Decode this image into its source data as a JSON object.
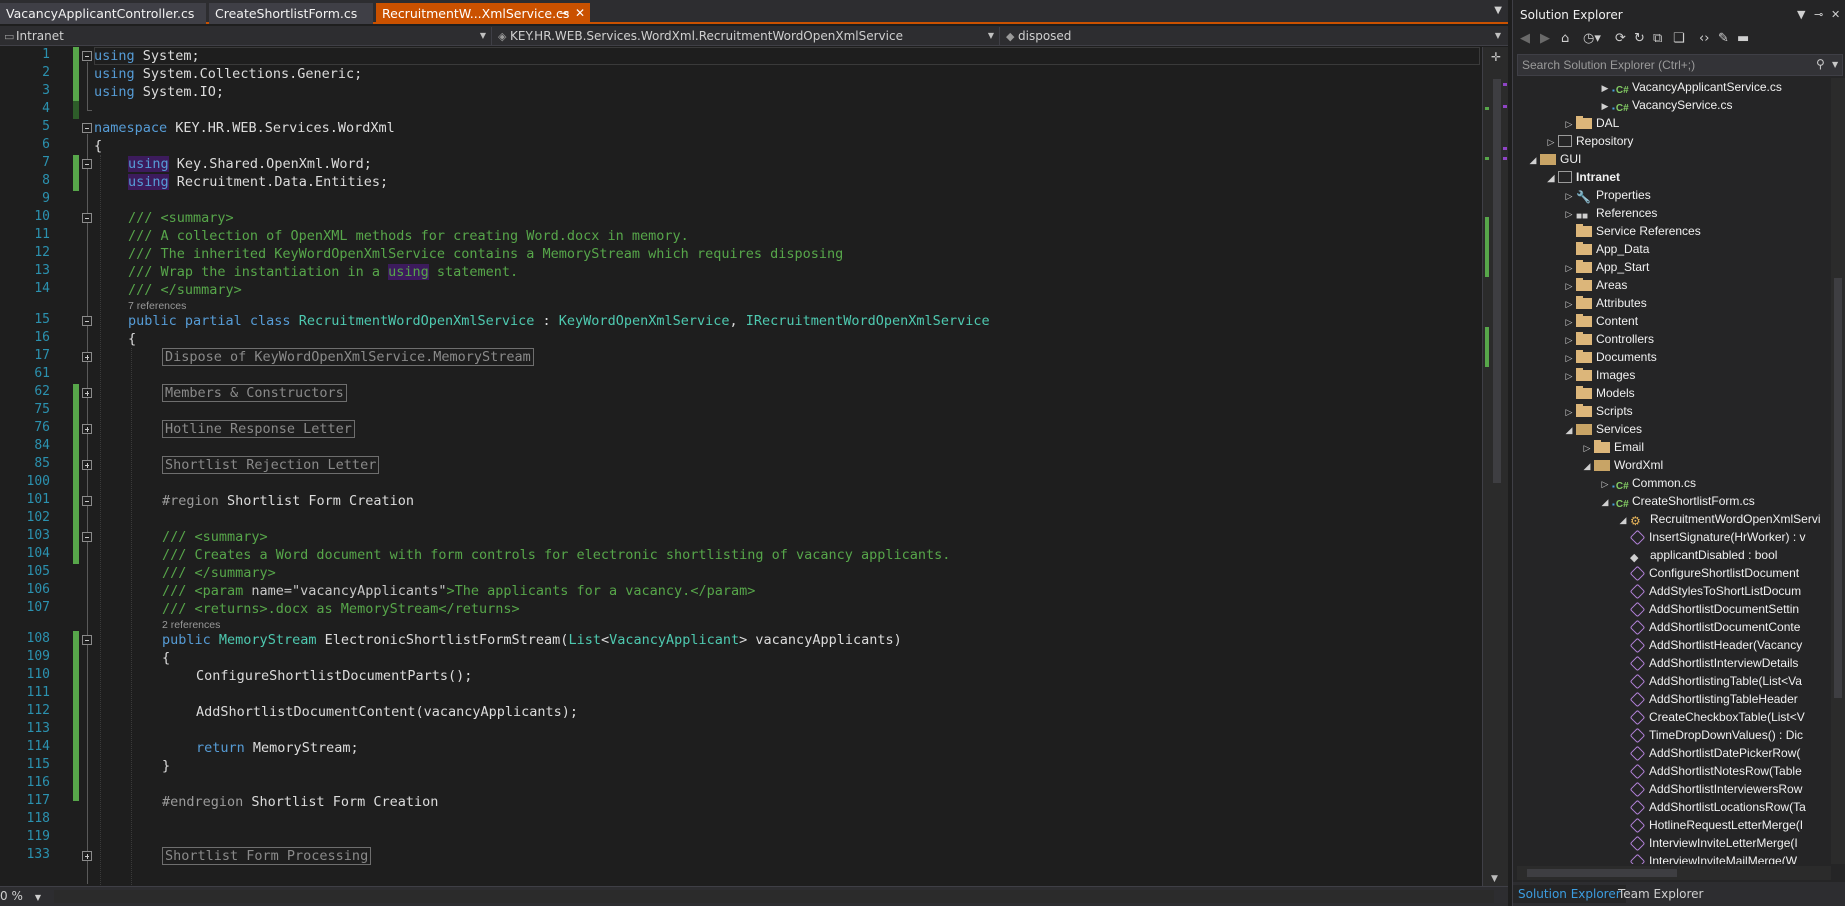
{
  "tabs": [
    {
      "label": "VacancyApplicantController.cs",
      "active": false
    },
    {
      "label": "CreateShortlistForm.cs",
      "active": false
    },
    {
      "label": "RecruitmentW...XmlService.cs",
      "active": true
    }
  ],
  "tab_pin_icon": "pin-icon",
  "tab_close_icon": "close-icon",
  "nav": {
    "project": "Intranet",
    "type": "KEY.HR.WEB.Services.WordXml.RecruitmentWordOpenXmlService",
    "member": "disposed"
  },
  "code": {
    "lines": [
      {
        "num": "1",
        "text": "using System;"
      },
      {
        "num": "2",
        "text": "using System.Collections.Generic;"
      },
      {
        "num": "3",
        "text": "using System.IO;"
      },
      {
        "num": "4",
        "text": ""
      },
      {
        "num": "5",
        "text": "namespace KEY.HR.WEB.Services.WordXml"
      },
      {
        "num": "6",
        "text": "{"
      },
      {
        "num": "7",
        "text": "using Key.Shared.OpenXml.Word;"
      },
      {
        "num": "8",
        "text": "using Recruitment.Data.Entities;"
      },
      {
        "num": "9",
        "text": ""
      },
      {
        "num": "10",
        "text": "/// <summary>"
      },
      {
        "num": "11",
        "text": "/// A collection of OpenXML methods for creating Word.docx in memory."
      },
      {
        "num": "12",
        "text": "/// The inherited KeyWordOpenXmlService contains a MemoryStream which requires disposing"
      },
      {
        "num": "13",
        "text": "/// Wrap the instantiation in a using statement."
      },
      {
        "num": "14",
        "text": "/// </summary>"
      },
      {
        "num": "15",
        "text": "public partial class RecruitmentWordOpenXmlService : KeyWordOpenXmlService, IRecruitmentWordOpenXmlService"
      },
      {
        "num": "16",
        "text": "{"
      },
      {
        "num": "17",
        "text": "Dispose of KeyWordOpenXmlService.MemoryStream"
      },
      {
        "num": "61",
        "text": ""
      },
      {
        "num": "62",
        "text": "Members & Constructors"
      },
      {
        "num": "75",
        "text": ""
      },
      {
        "num": "76",
        "text": "Hotline Response Letter"
      },
      {
        "num": "84",
        "text": ""
      },
      {
        "num": "85",
        "text": "Shortlist Rejection Letter"
      },
      {
        "num": "100",
        "text": ""
      },
      {
        "num": "101",
        "text": "#region Shortlist Form Creation"
      },
      {
        "num": "102",
        "text": ""
      },
      {
        "num": "103",
        "text": "/// <summary>"
      },
      {
        "num": "104",
        "text": "/// Creates a Word document with form controls for electronic shortlisting of vacancy applicants."
      },
      {
        "num": "105",
        "text": "/// </summary>"
      },
      {
        "num": "106",
        "text": "/// <param name=\"vacancyApplicants\">The applicants for a vacancy.</param>"
      },
      {
        "num": "107",
        "text": "/// <returns>.docx as MemoryStream</returns>"
      },
      {
        "num": "108",
        "text": "public MemoryStream ElectronicShortlistFormStream(List<VacancyApplicant> vacancyApplicants)"
      },
      {
        "num": "109",
        "text": "{"
      },
      {
        "num": "110",
        "text": "ConfigureShortlistDocumentParts();"
      },
      {
        "num": "111",
        "text": ""
      },
      {
        "num": "112",
        "text": "AddShortlistDocumentContent(vacancyApplicants);"
      },
      {
        "num": "113",
        "text": ""
      },
      {
        "num": "114",
        "text": "return MemoryStream;"
      },
      {
        "num": "115",
        "text": "}"
      },
      {
        "num": "116",
        "text": ""
      },
      {
        "num": "117",
        "text": "#endregion Shortlist Form Creation"
      },
      {
        "num": "118",
        "text": ""
      },
      {
        "num": "119",
        "text": "Shortlist Form Processing"
      },
      {
        "num": "133",
        "text": ""
      }
    ],
    "references_class": "7 references",
    "references_method": "2 references"
  },
  "editor_status": {
    "zoom": "0 %"
  },
  "solution_explorer": {
    "title": "Solution Explorer",
    "search_placeholder": "Search Solution Explorer (Ctrl+;)",
    "tree": [
      {
        "label": "VacancyApplicantService.cs",
        "icon": "csharp-file-icon"
      },
      {
        "label": "VacancyService.cs",
        "icon": "csharp-file-icon"
      },
      {
        "label": "DAL",
        "icon": "folder-icon"
      },
      {
        "label": "Repository",
        "icon": "project-icon"
      },
      {
        "label": "GUI",
        "icon": "folder-open-icon"
      },
      {
        "label": "Intranet",
        "icon": "web-project-icon"
      },
      {
        "label": "Properties",
        "icon": "wrench-icon"
      },
      {
        "label": "References",
        "icon": "references-icon"
      },
      {
        "label": "Service References",
        "icon": "folder-icon"
      },
      {
        "label": "App_Data",
        "icon": "folder-icon"
      },
      {
        "label": "App_Start",
        "icon": "folder-icon"
      },
      {
        "label": "Areas",
        "icon": "folder-icon"
      },
      {
        "label": "Attributes",
        "icon": "folder-icon"
      },
      {
        "label": "Content",
        "icon": "folder-icon"
      },
      {
        "label": "Controllers",
        "icon": "folder-icon"
      },
      {
        "label": "Documents",
        "icon": "folder-icon"
      },
      {
        "label": "Images",
        "icon": "folder-icon"
      },
      {
        "label": "Models",
        "icon": "folder-icon"
      },
      {
        "label": "Scripts",
        "icon": "folder-icon"
      },
      {
        "label": "Services",
        "icon": "folder-open-icon"
      },
      {
        "label": "Email",
        "icon": "folder-icon"
      },
      {
        "label": "WordXml",
        "icon": "folder-open-icon"
      },
      {
        "label": "Common.cs",
        "icon": "csharp-file-icon"
      },
      {
        "label": "CreateShortlistForm.cs",
        "icon": "csharp-file-icon"
      },
      {
        "label": "RecruitmentWordOpenXmlServi",
        "icon": "class-icon"
      },
      {
        "label": "InsertSignature(HrWorker) : v",
        "icon": "method-icon"
      },
      {
        "label": "applicantDisabled : bool",
        "icon": "field-icon"
      },
      {
        "label": "ConfigureShortlistDocument",
        "icon": "method-icon"
      },
      {
        "label": "AddStylesToShortListDocum",
        "icon": "method-icon"
      },
      {
        "label": "AddShortlistDocumentSettin",
        "icon": "method-icon"
      },
      {
        "label": "AddShortlistDocumentConte",
        "icon": "method-icon"
      },
      {
        "label": "AddShortlistHeader(Vacancy",
        "icon": "method-icon"
      },
      {
        "label": "AddShortlistInterviewDetails",
        "icon": "method-icon"
      },
      {
        "label": "AddShortlistingTable(List<Va",
        "icon": "method-icon"
      },
      {
        "label": "AddShortlistingTableHeader",
        "icon": "method-icon"
      },
      {
        "label": "CreateCheckboxTable(List<V",
        "icon": "method-icon"
      },
      {
        "label": "TimeDropDownValues() : Dic",
        "icon": "method-icon"
      },
      {
        "label": "AddShortlistDatePickerRow(",
        "icon": "method-icon"
      },
      {
        "label": "AddShortlistNotesRow(Table",
        "icon": "method-icon"
      },
      {
        "label": "AddShortlistInterviewersRow",
        "icon": "method-icon"
      },
      {
        "label": "AddShortlistLocationsRow(Ta",
        "icon": "method-icon"
      },
      {
        "label": "HotlineRequestLetterMerge(I",
        "icon": "method-icon"
      },
      {
        "label": "InterviewInviteLetterMerge(I",
        "icon": "method-icon"
      },
      {
        "label": "InterviewInviteMailMerge(W",
        "icon": "method-icon"
      }
    ],
    "bottom_tabs": [
      "Solution Explorer",
      "Team Explorer"
    ]
  }
}
